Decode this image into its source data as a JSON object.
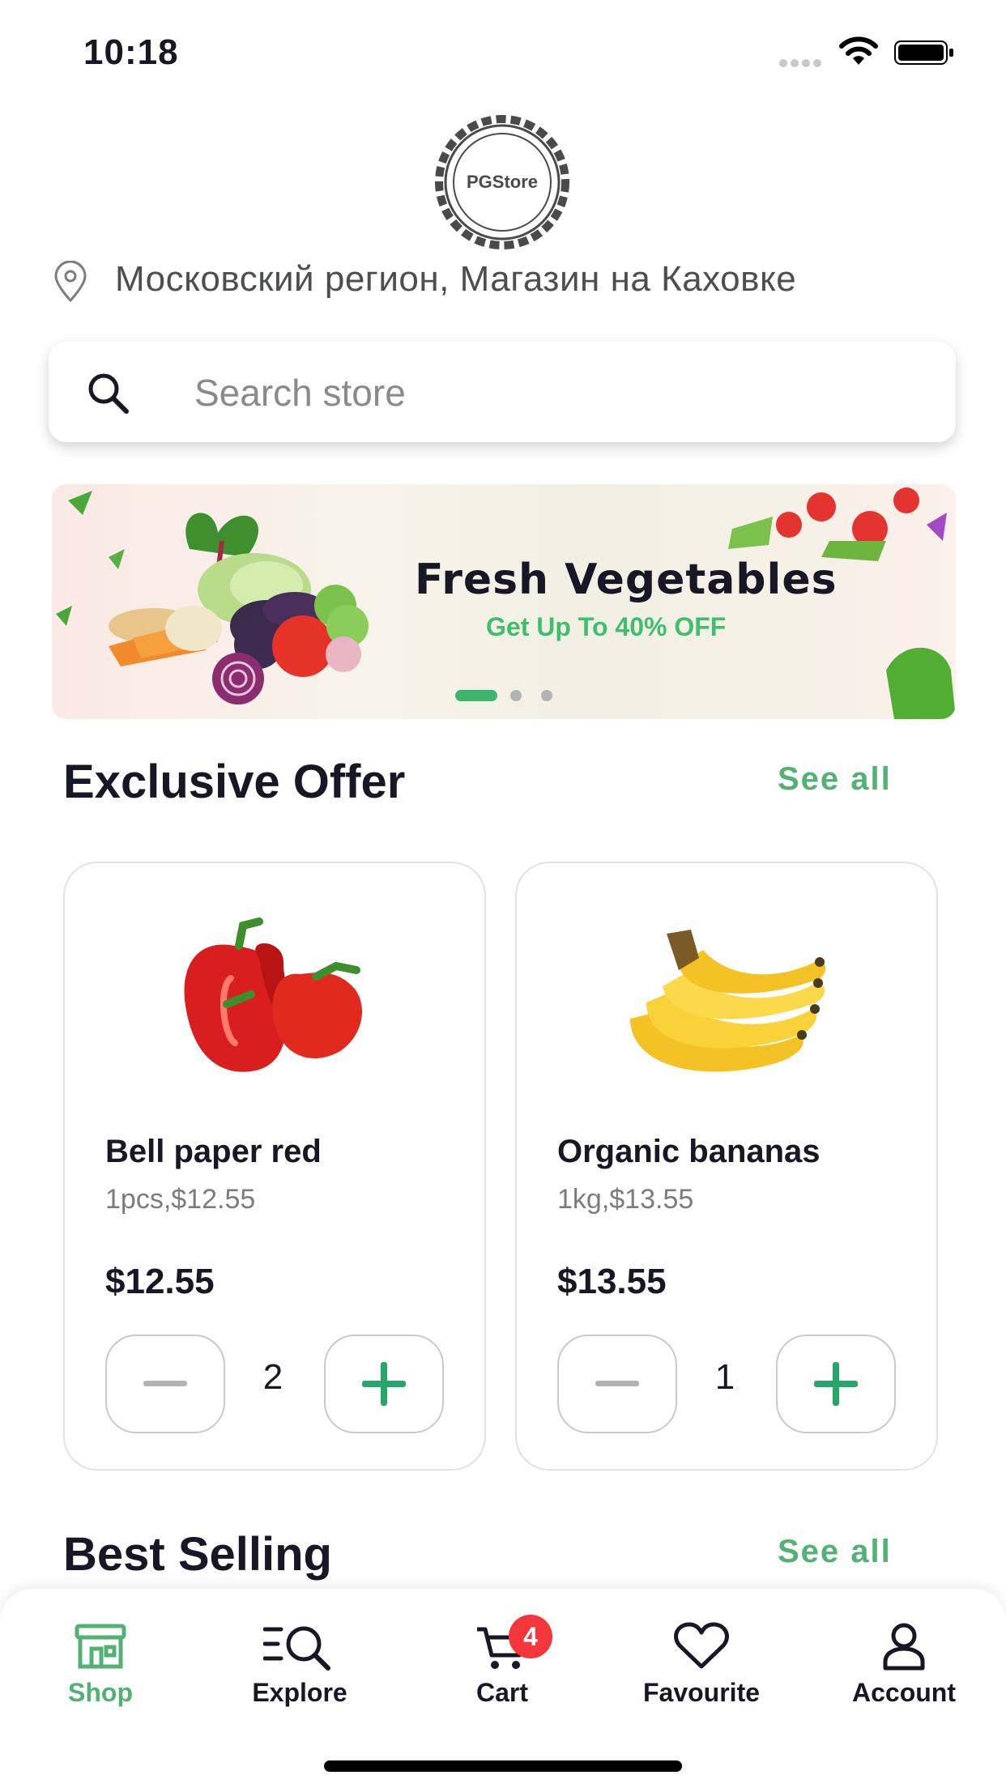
{
  "status_bar": {
    "time": "10:18"
  },
  "logo": {
    "text": "PGStore"
  },
  "location": {
    "text": "Московский регион, Магазин на Каховке"
  },
  "search": {
    "placeholder": "Search store"
  },
  "banner": {
    "title": "Fresh Vegetables",
    "subtitle": "Get Up To 40% OFF",
    "active_slide": 1,
    "slide_count": 3
  },
  "exclusive": {
    "title": "Exclusive Offer",
    "see_all": "See all",
    "products": [
      {
        "name": "Bell paper red",
        "sub": "1pcs,$12.55",
        "price": "$12.55",
        "qty": "2",
        "image_icon": "bell-pepper-image"
      },
      {
        "name": "Organic bananas",
        "sub": "1kg,$13.55",
        "price": "$13.55",
        "qty": "1",
        "image_icon": "banana-image"
      }
    ]
  },
  "best_selling": {
    "title": "Best Selling",
    "see_all": "See all"
  },
  "nav": {
    "items": [
      {
        "label": "Shop",
        "icon": "store-icon",
        "active": true
      },
      {
        "label": "Explore",
        "icon": "explore-icon"
      },
      {
        "label": "Cart",
        "icon": "cart-icon",
        "badge": "4"
      },
      {
        "label": "Favourite",
        "icon": "heart-icon"
      },
      {
        "label": "Account",
        "icon": "user-icon"
      }
    ]
  },
  "colors": {
    "accent": "#53b175",
    "badge": "#f3363c",
    "text": "#181725"
  }
}
